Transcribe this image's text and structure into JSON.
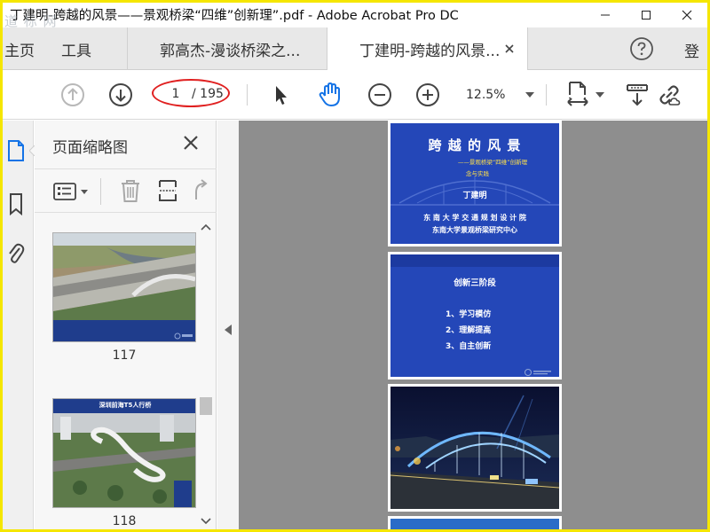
{
  "window": {
    "title": "丁建明-跨越的风景——景观桥梁“四维”创新理”.pdf - Adobe Acrobat Pro DC",
    "watermark": "道 标 网"
  },
  "tabs": {
    "home": "主页",
    "tools": "工具",
    "doc1": "郭高杰-漫谈桥梁之...",
    "doc2": "丁建明-跨越的风景..."
  },
  "header": {
    "login": "登"
  },
  "toolbar": {
    "page_current": "1",
    "page_total": "/ 195",
    "zoom": "12.5%"
  },
  "thumbnails": {
    "title": "页面缩略图",
    "items": [
      {
        "label": "117"
      },
      {
        "label": "118",
        "caption": "深圳前海T5人行桥"
      }
    ]
  },
  "pages": {
    "p1": {
      "title": "跨 越 的 风 景",
      "subtitle1": "——景观桥梁“四维”创新理",
      "subtitle2": "念与实践",
      "author": "丁建明",
      "org1": "东 南 大 学 交 通 规 划 设 计 院",
      "org2": "东南大学景观桥梁研究中心"
    },
    "p2": {
      "title": "创新三阶段",
      "items": [
        "1、学习模仿",
        "2、理解提高",
        "3、自主创新"
      ]
    }
  },
  "colors": {
    "slide_blue": "#2447b8",
    "acrobat_accent": "#1473e6",
    "annotation_red": "#e02020",
    "frame_yellow": "#f5e600"
  }
}
